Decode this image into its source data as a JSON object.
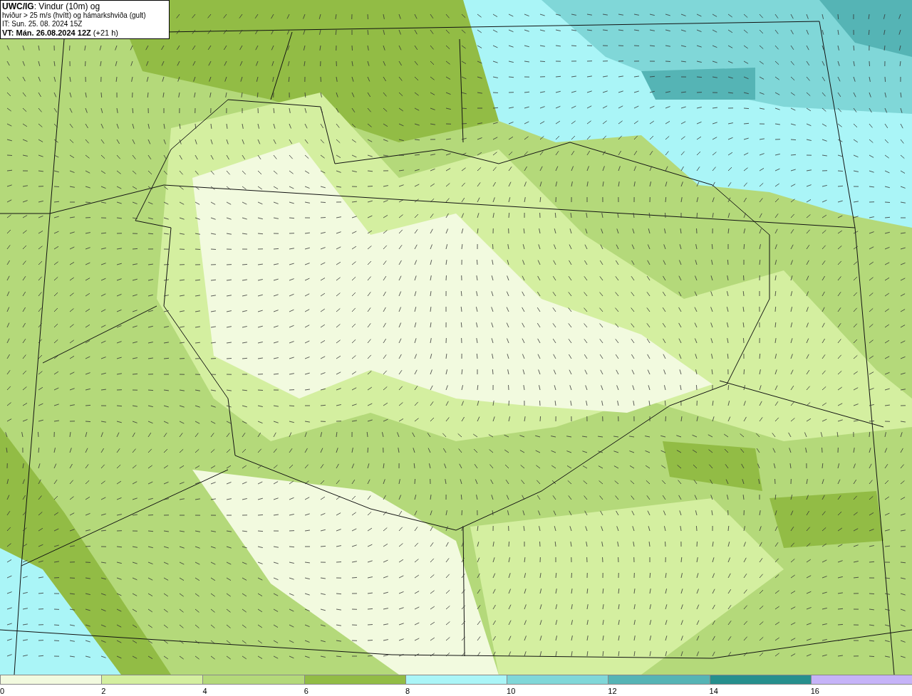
{
  "info_box": {
    "lines": [
      "**UWC/IG**: Vindur (10m) og",
      "hviður > 25 m/s (hvítt) og hámarkshviða (gult)",
      "IT: Sun. 25. 08. 2024 15Z",
      "**VT: Mán. 26.08.2024 12Z** (+21 h)"
    ]
  },
  "legend": {
    "segments": [
      {
        "label": "0",
        "color": "#f2fadf"
      },
      {
        "label": "2",
        "color": "#d4efa0"
      },
      {
        "label": "4",
        "color": "#b4d97a"
      },
      {
        "label": "6",
        "color": "#92bc45"
      },
      {
        "label": "8",
        "color": "#aaf5f7"
      },
      {
        "label": "10",
        "color": "#80d7d8"
      },
      {
        "label": "12",
        "color": "#55b4b5"
      },
      {
        "label": "14",
        "color": "#268f8d"
      },
      {
        "label": "16",
        "color": "#c5b3f8"
      }
    ]
  }
}
